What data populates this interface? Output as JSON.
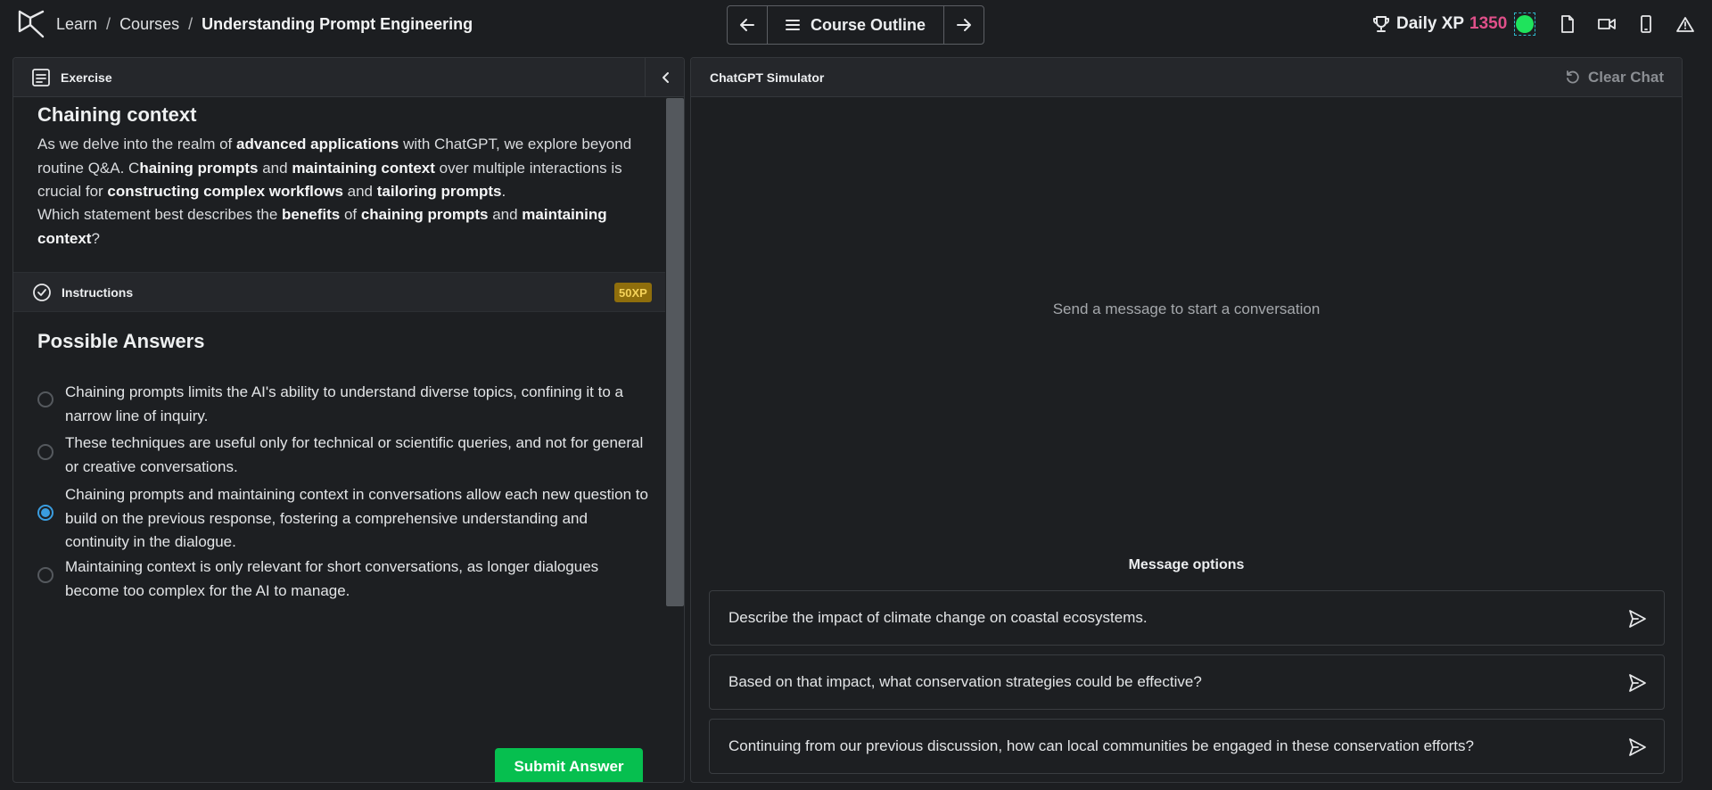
{
  "breadcrumb": {
    "items": [
      "Learn",
      "Courses"
    ],
    "separator": "/",
    "current": "Understanding Prompt Engineering"
  },
  "nav": {
    "prev_icon": "arrow-left-icon",
    "outline_label": "Course Outline",
    "outline_icon": "hamburger-menu-icon",
    "next_icon": "arrow-right-icon"
  },
  "xp": {
    "label": "Daily XP",
    "value": "1350",
    "value_color": "#e0508a",
    "status_color": "#1fe35c"
  },
  "toolbar_icons": [
    "document-icon",
    "video-icon",
    "mobile-icon",
    "warning-icon"
  ],
  "exercise": {
    "header_label": "Exercise",
    "title": "Chaining context",
    "paragraph1": [
      {
        "t": "As we delve into the realm of ",
        "b": false
      },
      {
        "t": "advanced applications",
        "b": true
      },
      {
        "t": " with ChatGPT, we explore beyond routine Q&A. C",
        "b": false
      },
      {
        "t": "haining prompts",
        "b": true
      },
      {
        "t": " and ",
        "b": false
      },
      {
        "t": "maintaining context",
        "b": true
      },
      {
        "t": " over multiple interactions is crucial for ",
        "b": false
      },
      {
        "t": "constructing complex workflows",
        "b": true
      },
      {
        "t": " and ",
        "b": false
      },
      {
        "t": "tailoring prompts",
        "b": true
      },
      {
        "t": ".",
        "b": false
      }
    ],
    "paragraph2": [
      {
        "t": "Which statement best describes the ",
        "b": false
      },
      {
        "t": "benefits",
        "b": true
      },
      {
        "t": " of ",
        "b": false
      },
      {
        "t": "chaining prompts",
        "b": true
      },
      {
        "t": " and ",
        "b": false
      },
      {
        "t": "maintaining context",
        "b": true
      },
      {
        "t": "?",
        "b": false
      }
    ]
  },
  "instructions": {
    "label": "Instructions",
    "xp_badge": "50XP"
  },
  "answers": {
    "title": "Possible Answers",
    "selected_index": 2,
    "items": [
      "Chaining prompts limits the AI's ability to understand diverse topics, confining it to a narrow line of inquiry.",
      "These techniques are useful only for technical or scientific queries, and not for general or creative conversations.",
      "Chaining prompts and maintaining context in conversations allow each new question to build on the previous response, fostering a comprehensive understanding and continuity in the dialogue.",
      "Maintaining context is only relevant for short conversations, as longer dialogues become too complex for the AI to manage."
    ],
    "submit_label": "Submit Answer"
  },
  "simulator": {
    "title": "ChatGPT Simulator",
    "clear_label": "Clear Chat",
    "empty_message": "Send a message to start a conversation",
    "options_title": "Message options",
    "options": [
      "Describe the impact of climate change on coastal ecosystems.",
      "Based on that impact, what conservation strategies could be effective?",
      "Continuing from our previous discussion, how can local communities be engaged in these conservation efforts?"
    ]
  }
}
